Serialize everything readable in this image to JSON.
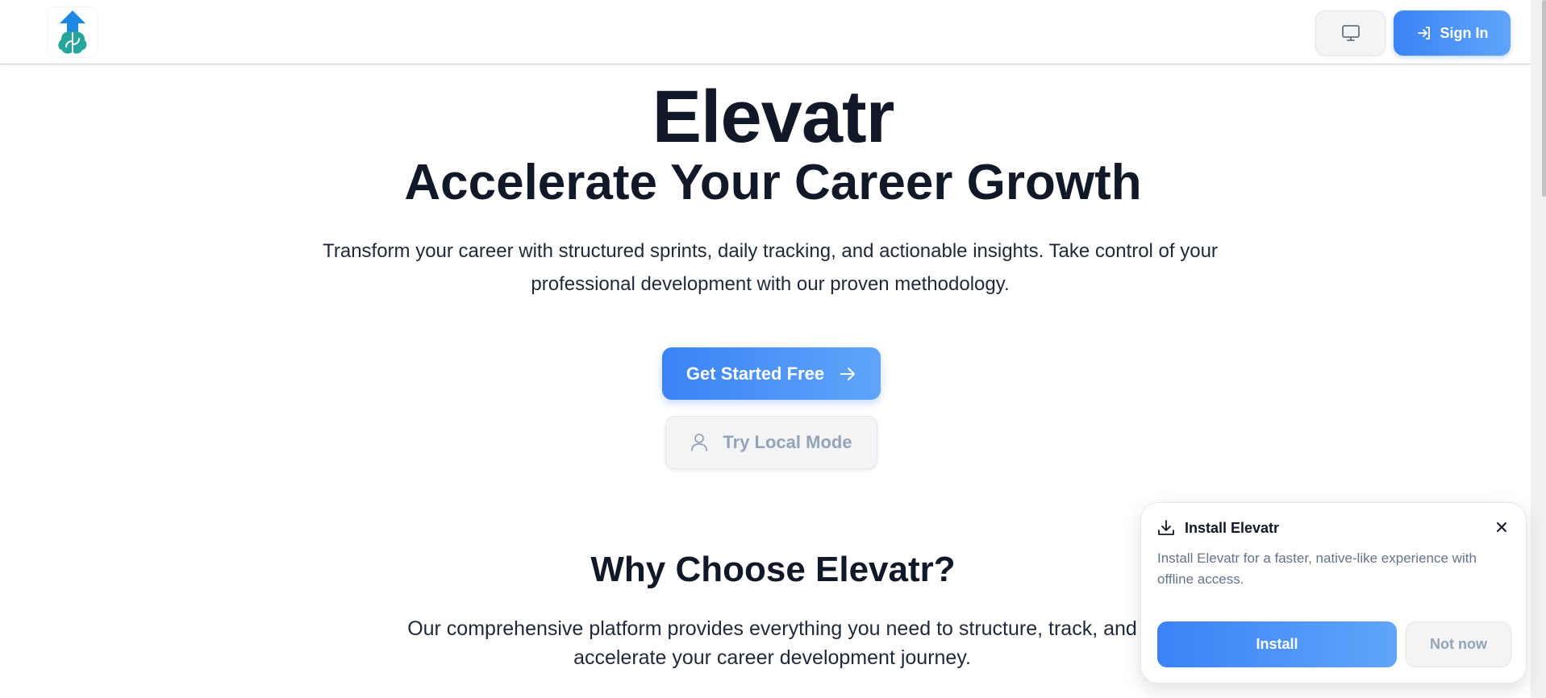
{
  "header": {
    "logo_icon": "brain-arrow-up-logo",
    "display_icon": "monitor-icon",
    "signin_icon": "sign-in-icon",
    "signin_label": "Sign In"
  },
  "hero": {
    "title": "Elevatr",
    "subtitle": "Accelerate Your Career Growth",
    "description": "Transform your career with structured sprints, daily tracking, and actionable insights. Take control of your professional development with our proven methodology.",
    "primary_cta": "Get Started Free",
    "primary_cta_icon": "arrow-right-icon",
    "secondary_cta": "Try Local Mode",
    "secondary_cta_icon": "user-icon"
  },
  "why": {
    "title": "Why Choose Elevatr?",
    "description": "Our comprehensive platform provides everything you need to structure, track, and accelerate your career development journey."
  },
  "install_prompt": {
    "icon": "download-icon",
    "title": "Install Elevatr",
    "description": "Install Elevatr for a faster, native-like experience with offline access.",
    "install_label": "Install",
    "dismiss_label": "Not now",
    "close_icon": "close-icon"
  },
  "colors": {
    "accent": "#3b82f6",
    "accent_light": "#60a5fa",
    "text": "#111827",
    "muted": "#94a3b8"
  }
}
